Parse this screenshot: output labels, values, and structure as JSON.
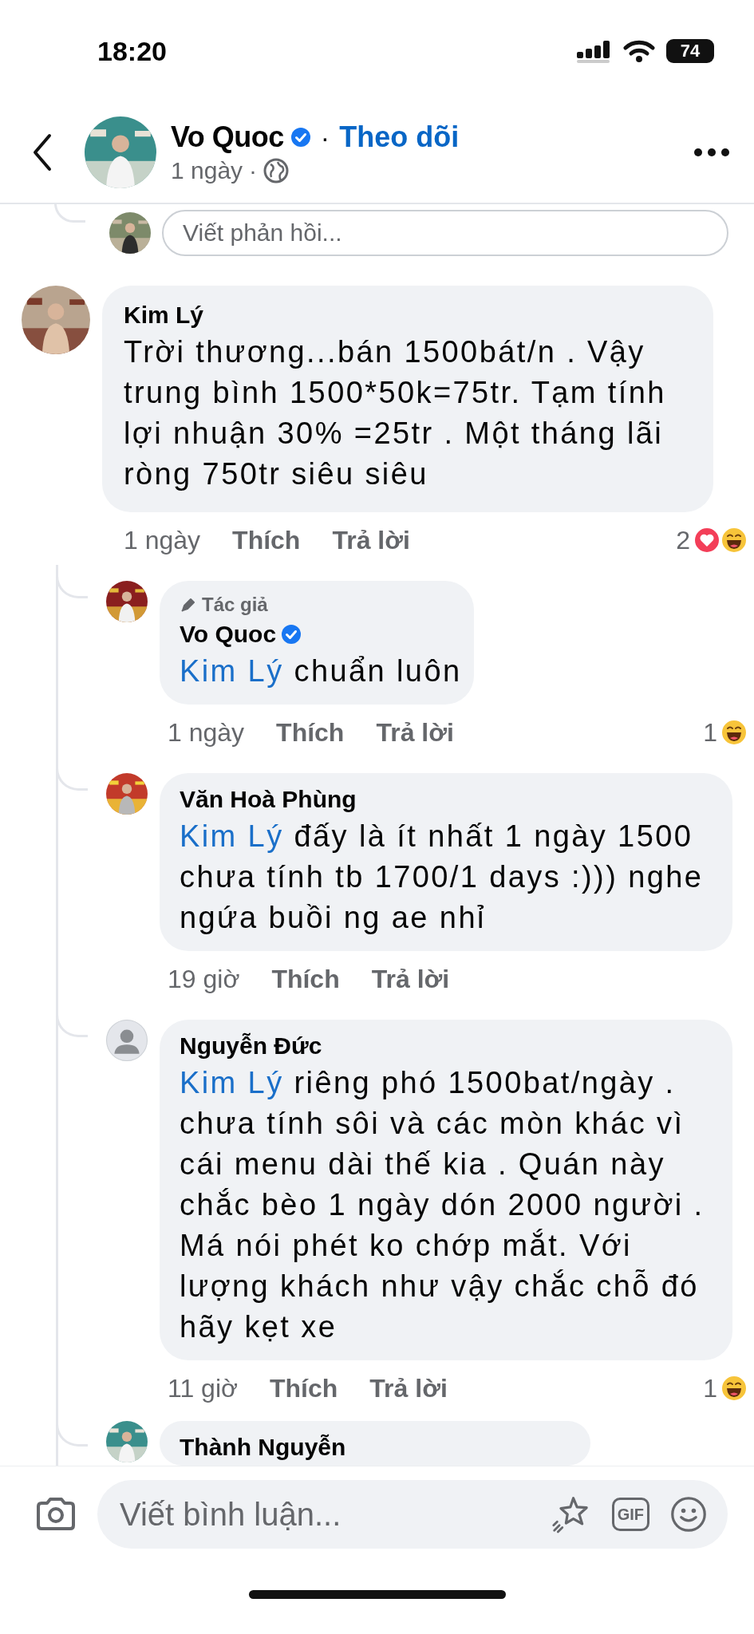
{
  "status_bar": {
    "time": "18:20",
    "battery": "74"
  },
  "header": {
    "author": "Vo Quoc",
    "verified": true,
    "separator": "·",
    "follow": "Theo dõi",
    "time": "1 ngày",
    "time_separator": "·"
  },
  "reply_box": {
    "placeholder": "Viết phản hồi..."
  },
  "comments": [
    {
      "author": "Kim Lý",
      "text": "Trời thương...bán 1500bát/n . Vậy trung bình 1500*50k=75tr. Tạm tính lợi nhuận 30% =25tr . Một tháng lãi ròng 750tr siêu siêu",
      "time": "1 ngày",
      "like": "Thích",
      "reply": "Trả lời",
      "reaction_count": "2",
      "reactions": [
        {
          "kind": "love"
        },
        {
          "kind": "haha"
        }
      ],
      "replies": [
        {
          "badge": "Tác giả",
          "author": "Vo Quoc",
          "verified": true,
          "has_photo": true,
          "mention": "Kim Lý",
          "text": "chuẩn luôn",
          "time": "1 ngày",
          "like": "Thích",
          "reply": "Trả lời",
          "reaction_count": "1",
          "reactions": [
            {
              "kind": "haha"
            }
          ]
        },
        {
          "author": "Văn Hoà Phùng",
          "verified": false,
          "has_photo": true,
          "mention": "Kim Lý",
          "text": "đấy là ít nhất 1 ngày 1500 chưa tính tb 1700/1 days :))) nghe ngứa buồi ng ae nhỉ",
          "time": "19 giờ",
          "like": "Thích",
          "reply": "Trả lời"
        },
        {
          "author": "Nguyễn Đức",
          "verified": false,
          "has_photo": false,
          "mention": "Kim Lý",
          "text": "riêng phó 1500bat/ngày . chưa tính sôi và các mòn khác vì cái menu dài thế kia . Quán này chắc bèo 1 ngày dón 2000 người . Má nói phét ko chớp mắt. Với lượng khách như vậy chắc chỗ đó hãy kẹt xe",
          "time": "11 giờ",
          "like": "Thích",
          "reply": "Trả lời",
          "reaction_count": "1",
          "reactions": [
            {
              "kind": "haha"
            }
          ]
        },
        {
          "author": "Thành Nguyễn",
          "verified": false,
          "has_photo": true
        }
      ]
    }
  ],
  "composer": {
    "placeholder": "Viết bình luận...",
    "gif": "GIF"
  }
}
